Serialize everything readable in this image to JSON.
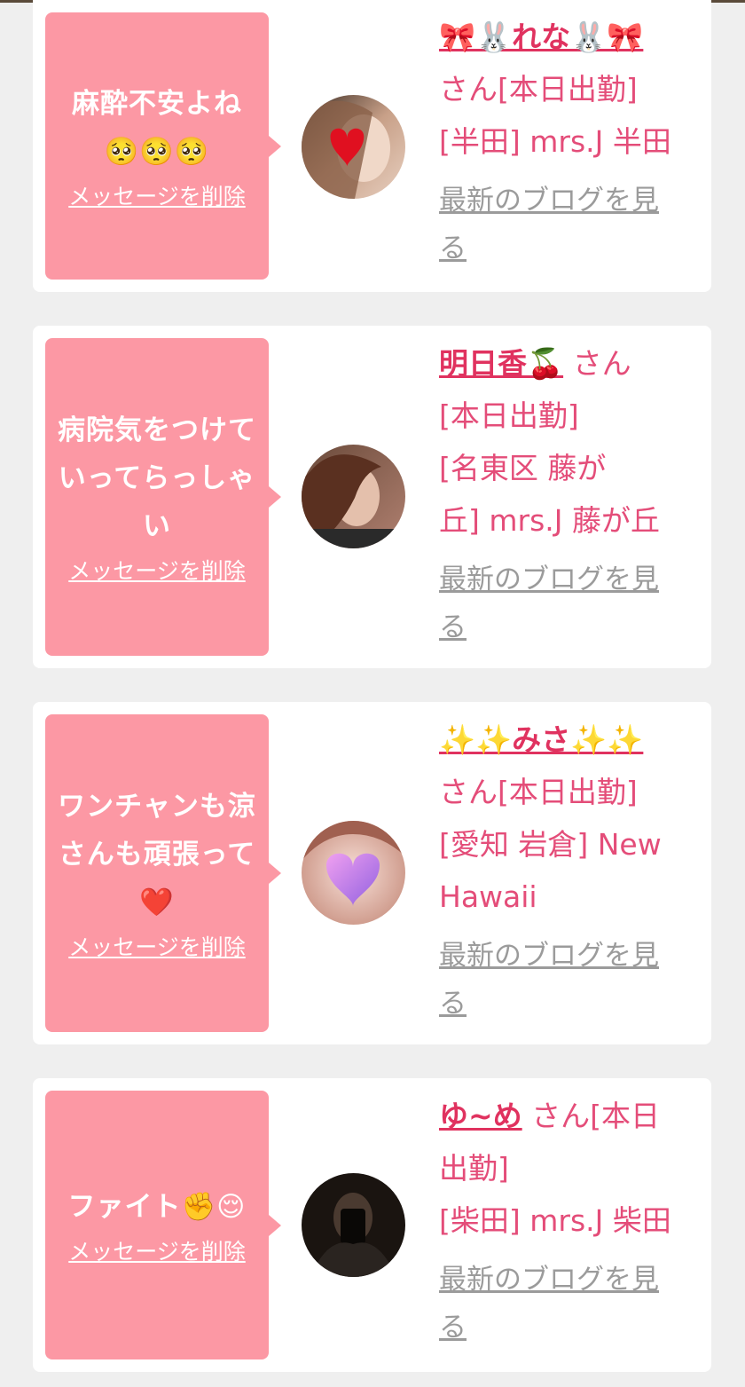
{
  "messages": [
    {
      "message": "麻酔不安よね\n🥺🥺🥺",
      "delete_label": "メッセージを削除",
      "name": "🎀🐰れな🐰🎀",
      "suffix": "\nさん[本日出勤]\n[半田] mrs.J 半田",
      "blog_label": "最新のブログを見\nる"
    },
    {
      "message": "病院気をつけて\nいってらっしゃ\nい",
      "delete_label": "メッセージを削除",
      "name": "明日香🍒",
      "suffix": "  さん\n[本日出勤]\n[名東区 藤が\n丘] mrs.J 藤が丘",
      "blog_label": "最新のブログを見\nる"
    },
    {
      "message": "ワンチャンも涼\nさんも頑張って\n❤️",
      "delete_label": "メッセージを削除",
      "name": "✨✨みさ✨✨",
      "suffix": "\nさん[本日出勤]\n[愛知 岩倉] New\nHawaii",
      "blog_label": "最新のブログを見\nる"
    },
    {
      "message": "ファイト✊😌",
      "delete_label": "メッセージを削除",
      "name": "ゆ~め",
      "suffix": "  さん[本日\n出勤]\n[柴田] mrs.J 柴田",
      "blog_label": "最新のブログを見\nる"
    }
  ]
}
